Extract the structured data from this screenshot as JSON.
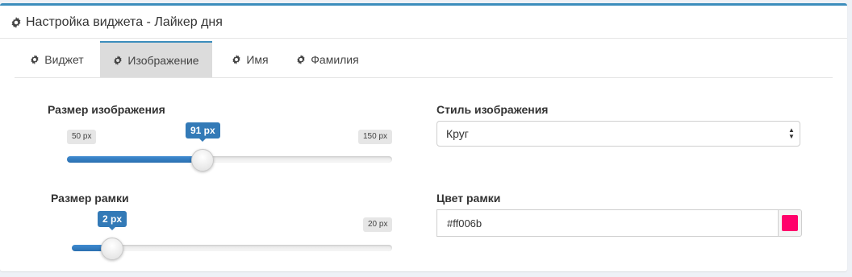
{
  "header": {
    "title": "Настройка виджета - Лайкер дня"
  },
  "tabs": [
    {
      "label": "Виджет",
      "active": false
    },
    {
      "label": "Изображение",
      "active": true
    },
    {
      "label": "Имя",
      "active": false
    },
    {
      "label": "Фамилия",
      "active": false
    }
  ],
  "image_size": {
    "label": "Размер изображения",
    "min_label": "50 px",
    "max_label": "150 px",
    "value_label": "91 px",
    "min": 50,
    "max": 150,
    "value": 91
  },
  "border_size": {
    "label": "Размер рамки",
    "max_label": "20 px",
    "value_label": "2 px",
    "min": 0,
    "max": 20,
    "value": 2
  },
  "image_style": {
    "label": "Стиль изображения",
    "selected": "Круг"
  },
  "border_color": {
    "label": "Цвет рамки",
    "value": "#ff006b"
  },
  "colors": {
    "accent": "#3c8dbc",
    "slider_fill": "#337ab7",
    "swatch": "#ff006b"
  }
}
